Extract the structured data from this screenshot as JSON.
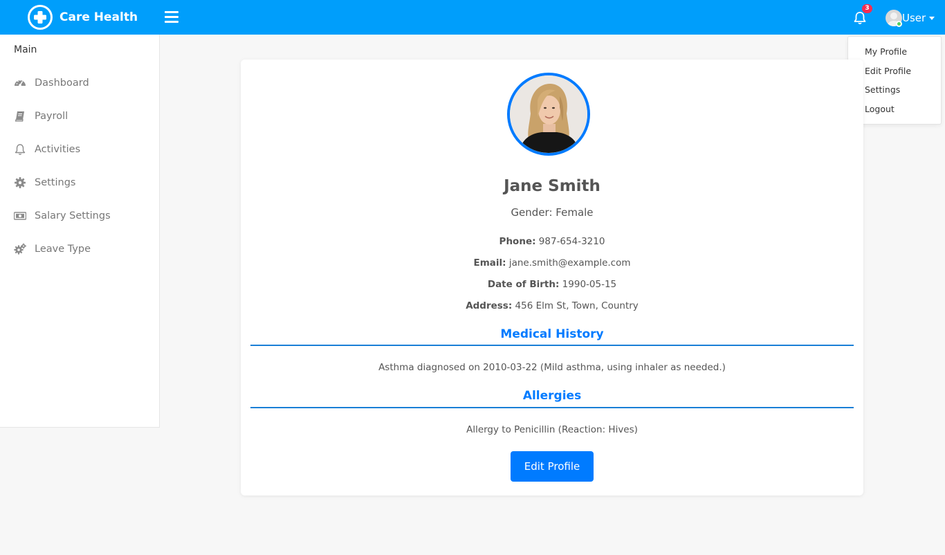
{
  "header": {
    "brand": "Care Health",
    "notification_count": "3",
    "user_label": "User"
  },
  "user_dropdown": {
    "items": [
      "My Profile",
      "Edit Profile",
      "Settings",
      "Logout"
    ]
  },
  "sidebar": {
    "section_title": "Main",
    "items": [
      {
        "label": "Dashboard",
        "icon": "dashboard-icon"
      },
      {
        "label": "Payroll",
        "icon": "book-icon"
      },
      {
        "label": "Activities",
        "icon": "bell-icon"
      },
      {
        "label": "Settings",
        "icon": "gear-icon"
      },
      {
        "label": "Salary Settings",
        "icon": "money-icon"
      },
      {
        "label": "Leave Type",
        "icon": "gears-icon"
      }
    ]
  },
  "profile": {
    "name": "Jane Smith",
    "gender_label": "Gender:",
    "gender": "Female",
    "phone_label": "Phone:",
    "phone": "987-654-3210",
    "email_label": "Email:",
    "email": "jane.smith@example.com",
    "dob_label": "Date of Birth:",
    "dob": "1990-05-15",
    "address_label": "Address:",
    "address": "456 Elm St, Town, Country"
  },
  "medical_history": {
    "title": "Medical History",
    "entry": "Asthma diagnosed on 2010-03-22 (Mild asthma, using inhaler as needed.)"
  },
  "allergies": {
    "title": "Allergies",
    "entry": "Allergy to Penicillin (Reaction: Hives)"
  },
  "actions": {
    "edit_profile": "Edit Profile"
  },
  "colors": {
    "header_bg": "#009efb",
    "accent": "#007bff",
    "badge": "#f62d51",
    "online": "#55ce63"
  }
}
